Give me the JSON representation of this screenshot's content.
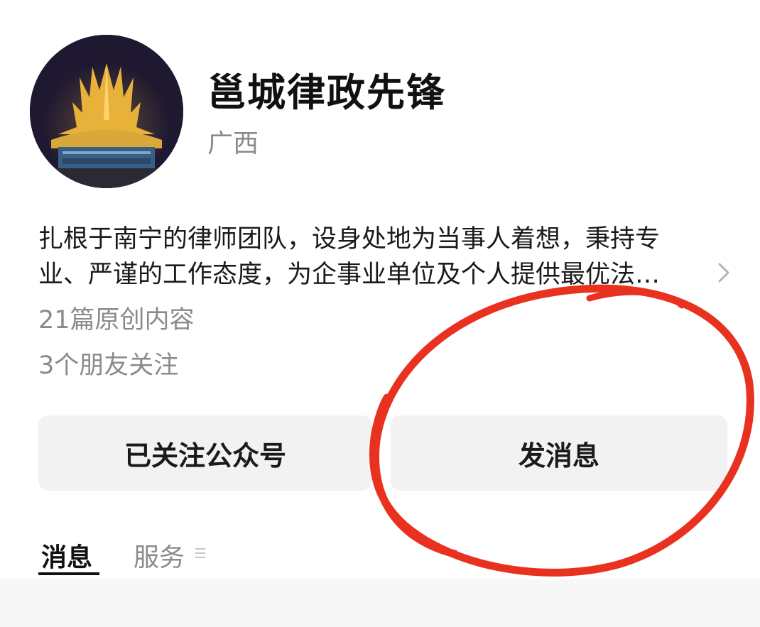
{
  "profile": {
    "name": "邕城律政先锋",
    "region": "广西",
    "avatar_icon": "building-photo"
  },
  "description": {
    "line1": "扎根于南宁的律师团队，设身处地为当事人着想，秉持专",
    "line2": "业、严谨的工作态度，为企事业单位及个人提供最优法…"
  },
  "stats": {
    "articles": "21篇原创内容",
    "friends": "3个朋友关注"
  },
  "actions": {
    "follow_label": "已关注公众号",
    "message_label": "发消息"
  },
  "tabs": [
    {
      "label": "消息",
      "active": true
    },
    {
      "label": "服务",
      "active": false
    }
  ],
  "colors": {
    "annotation_red": "#e8321f",
    "button_bg": "#f2f2f2",
    "muted_text": "#8a8a8a"
  }
}
